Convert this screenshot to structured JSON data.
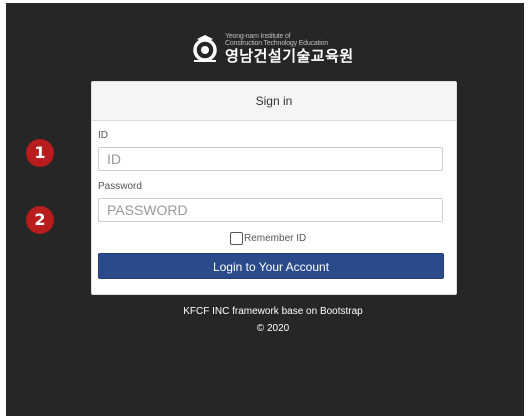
{
  "brand": {
    "subtitle_line1": "Yeong-nam Institute of",
    "subtitle_line2": "Construction Technology Education",
    "name": "영남건설기술교육원"
  },
  "login_card": {
    "heading": "Sign in",
    "id_label": "ID",
    "id_value": "",
    "id_placeholder": "ID",
    "password_label": "Password",
    "password_value": "",
    "password_placeholder": "PASSWORD",
    "remember_label": "Remember ID",
    "remember_checked": false,
    "submit_label": "Login to Your Account"
  },
  "footer": {
    "framework_text": "KFCF INC framework base on Bootstrap",
    "copyright": "© 2020"
  },
  "markers": [
    {
      "label": "1"
    },
    {
      "label": "2"
    }
  ],
  "colors": {
    "background": "#262626",
    "primary_button": "#2b4a8c",
    "marker": "#b81c1c"
  },
  "icons": {
    "logo": "institute-logo-icon",
    "remember": "checkbox-icon"
  }
}
